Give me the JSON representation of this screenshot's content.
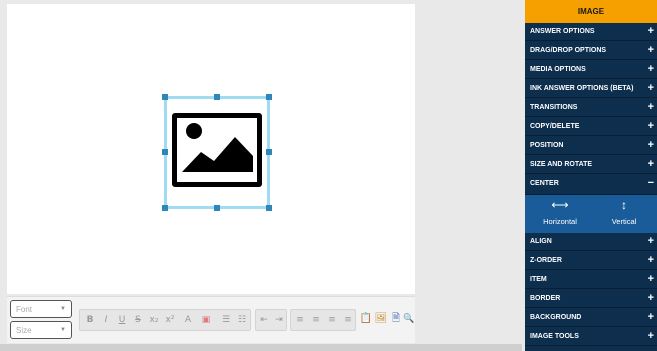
{
  "toolbar": {
    "font_placeholder": "Font",
    "size_placeholder": "Size",
    "buttons": [
      "B",
      "I",
      "U",
      "S",
      "x₂",
      "x²",
      "A",
      "▣",
      "☰",
      "☷",
      "⇤",
      "⇥",
      "≡",
      "≡",
      "≡",
      "≡",
      "📋",
      "🖼",
      "🗎",
      "🔍"
    ]
  },
  "panel": {
    "title": "IMAGE",
    "sections": [
      {
        "label": "ANSWER OPTIONS",
        "sign": "+"
      },
      {
        "label": "DRAG/DROP OPTIONS",
        "sign": "+"
      },
      {
        "label": "MEDIA OPTIONS",
        "sign": "+"
      },
      {
        "label": "INK ANSWER OPTIONS (BETA)",
        "sign": "+"
      },
      {
        "label": "TRANSITIONS",
        "sign": "+"
      },
      {
        "label": "COPY/DELETE",
        "sign": "+"
      },
      {
        "label": "POSITION",
        "sign": "+"
      },
      {
        "label": "SIZE AND ROTATE",
        "sign": "+"
      },
      {
        "label": "CENTER",
        "sign": "−"
      },
      {
        "label": "ALIGN",
        "sign": "+"
      },
      {
        "label": "Z-ORDER",
        "sign": "+"
      },
      {
        "label": "ITEM",
        "sign": "+"
      },
      {
        "label": "BORDER",
        "sign": "+"
      },
      {
        "label": "BACKGROUND",
        "sign": "+"
      },
      {
        "label": "IMAGE TOOLS",
        "sign": "+"
      }
    ],
    "center": {
      "horizontal_label": "Horizontal",
      "vertical_label": "Vertical"
    }
  },
  "colors": {
    "panel_bg": "#0e2e4e",
    "panel_title_bg": "#f6a000",
    "center_active_bg": "#1a5c99",
    "selection_border": "#9fdcf3",
    "handle": "#2e86b9"
  }
}
